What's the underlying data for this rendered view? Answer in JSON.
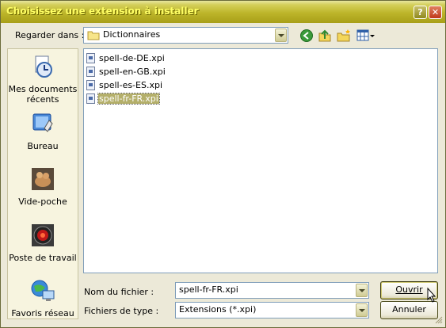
{
  "window": {
    "title": "Choisissez une extension à installer"
  },
  "toolbar": {
    "look_in_label": "Regarder dans :",
    "look_in_value": "Dictionnaires"
  },
  "places": [
    {
      "label_line1": "Mes documents",
      "label_line2": "récents",
      "icon": "recent-documents-icon"
    },
    {
      "label_line1": "Bureau",
      "label_line2": "",
      "icon": "desktop-icon"
    },
    {
      "label_line1": "Vide-poche",
      "label_line2": "",
      "icon": "vide-poche-icon"
    },
    {
      "label_line1": "Poste de travail",
      "label_line2": "",
      "icon": "workstation-icon"
    },
    {
      "label_line1": "Favoris réseau",
      "label_line2": "",
      "icon": "network-favorites-icon"
    }
  ],
  "files": [
    {
      "name": "spell-de-DE.xpi",
      "selected": false
    },
    {
      "name": "spell-en-GB.xpi",
      "selected": false
    },
    {
      "name": "spell-es-ES.xpi",
      "selected": false
    },
    {
      "name": "spell-fr-FR.xpi",
      "selected": true
    }
  ],
  "filename": {
    "label": "Nom du fichier :",
    "value": "spell-fr-FR.xpi"
  },
  "filetype": {
    "label": "Fichiers de type :",
    "value": "Extensions (*.xpi)"
  },
  "buttons": {
    "open": "Ouvrir",
    "cancel": "Annuler"
  },
  "colors": {
    "title_bar": "#bdb52a",
    "selection": "#b4af6a",
    "dialog_bg": "#ece9d8"
  }
}
